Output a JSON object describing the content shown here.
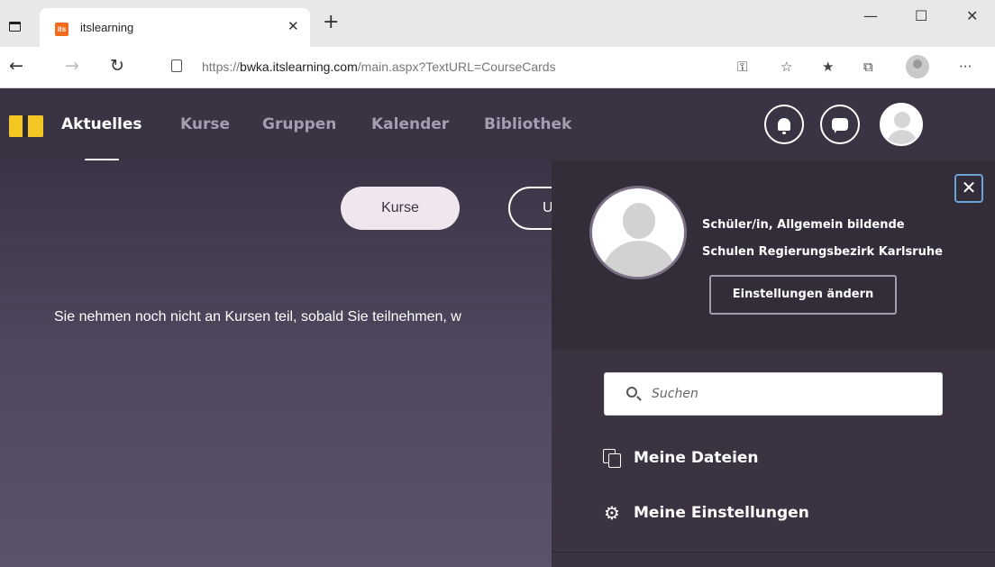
{
  "browser": {
    "tab_title": "itslearning",
    "tab_favicon": "its",
    "close_tab_glyph": "✕",
    "new_tab_glyph": "+",
    "url_prefix": "https://",
    "url_domain": "bwka.itslearning.com",
    "url_path": "/main.aspx?TextURL=CourseCards",
    "window_controls": [
      "—",
      "☐",
      "✕"
    ],
    "nav": {
      "back": "←",
      "forward": "→",
      "reload": "↻"
    },
    "toolbar_icons": [
      "key-icon",
      "favorite-add-icon",
      "favorites-icon",
      "collections-icon",
      "profile-icon",
      "more-icon"
    ],
    "more_glyph": "···"
  },
  "app": {
    "nav_items": [
      {
        "label": "Aktuelles",
        "active": true
      },
      {
        "label": "Kurse",
        "active": false
      },
      {
        "label": "Gruppen",
        "active": false
      },
      {
        "label": "Kalender",
        "active": false
      },
      {
        "label": "Bibliothek",
        "active": false
      }
    ],
    "colors": {
      "nav_bg": "#3a3344",
      "panel_bg": "#3b3341",
      "accent_close": "#6ba3d6"
    }
  },
  "main": {
    "pill_active": "Kurse",
    "pill_other": "U",
    "message": "Sie nehmen noch nicht an Kursen teil, sobald Sie teilnehmen, w"
  },
  "panel": {
    "close_glyph": "✕",
    "user_line1": "Schüler/in, Allgemein bildende",
    "user_line2": "Schulen Regierungsbezirk Karlsruhe",
    "settings_button": "Einstellungen ändern",
    "search_placeholder": "Suchen",
    "menu": [
      {
        "label": "Meine Dateien",
        "icon": "files-icon"
      },
      {
        "label": "Meine Einstellungen",
        "icon": "gear-icon"
      }
    ]
  }
}
